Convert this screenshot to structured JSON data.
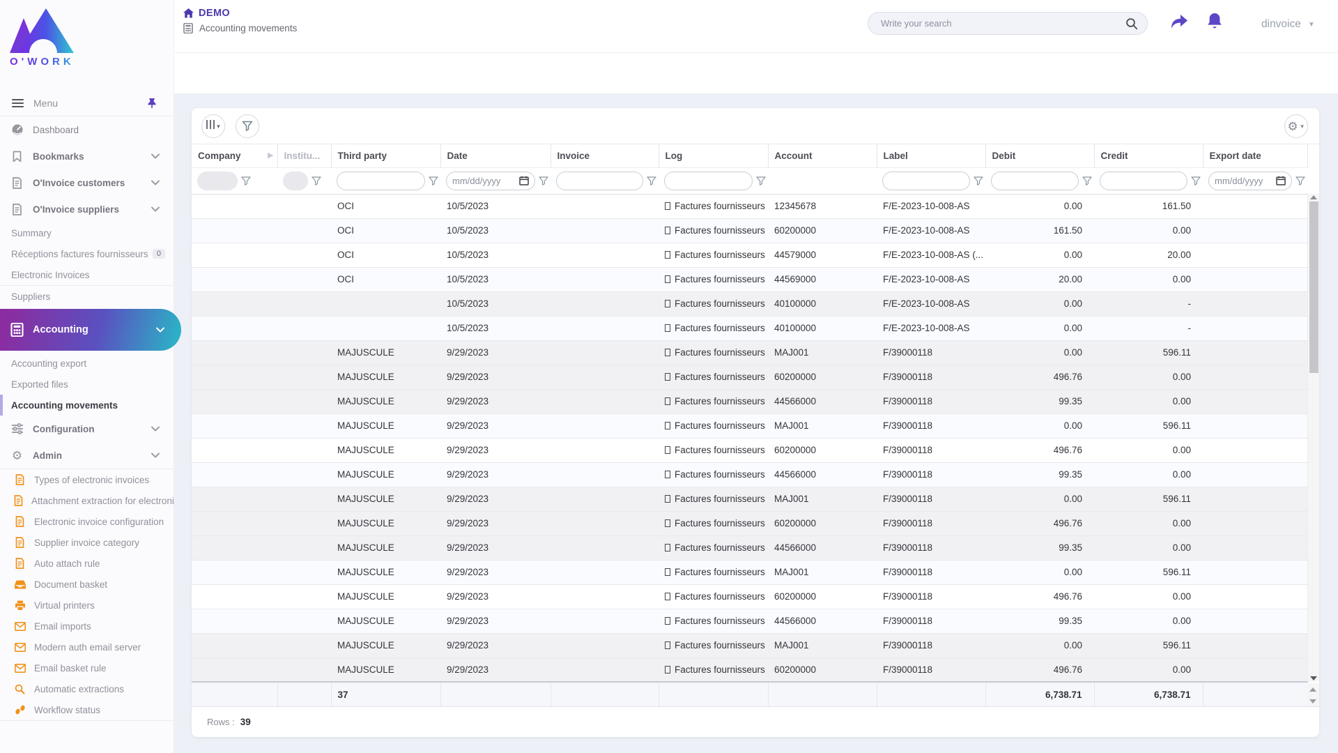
{
  "app": {
    "logo_text": "O'WORK",
    "accent_purple": "#5b46c6",
    "accent_teal": "#28b9c7",
    "admin_icon_orange": "#f2921c",
    "active_gradient": [
      "#8a2da1",
      "#28b9c7"
    ]
  },
  "header": {
    "title": "DEMO",
    "breadcrumb": "Accounting movements",
    "search_placeholder": "Write your search",
    "user": "dinvoice"
  },
  "sidebar": {
    "menu_label": "Menu",
    "items": [
      {
        "id": "dashboard",
        "label": "Dashboard",
        "icon": "dashboard",
        "type": "top"
      },
      {
        "id": "bookmarks",
        "label": "Bookmarks",
        "icon": "bookmark",
        "type": "top",
        "bold": true,
        "chevron": true
      },
      {
        "id": "oinvoice-customers",
        "label": "O'Invoice customers",
        "icon": "invoice",
        "type": "top",
        "bold": true,
        "chevron": true
      },
      {
        "id": "oinvoice-suppliers",
        "label": "O'Invoice suppliers",
        "icon": "invoice",
        "type": "top",
        "bold": true,
        "chevron": true
      },
      {
        "id": "summary",
        "label": "Summary",
        "type": "sub"
      },
      {
        "id": "receptions-factures-fournisseurs",
        "label": "Réceptions factures fournisseurs",
        "type": "sub",
        "badge": "0"
      },
      {
        "id": "electronic-invoices",
        "label": "Electronic Invoices",
        "type": "sub"
      },
      {
        "type": "divider"
      },
      {
        "id": "suppliers",
        "label": "Suppliers",
        "type": "sub"
      },
      {
        "id": "accounting",
        "label": "Accounting",
        "icon": "calculator",
        "type": "pill",
        "chevron": true
      },
      {
        "id": "accounting-export",
        "label": "Accounting export",
        "type": "sub"
      },
      {
        "id": "exported-files",
        "label": "Exported files",
        "type": "sub"
      },
      {
        "id": "accounting-movements",
        "label": "Accounting movements",
        "type": "sub",
        "active": true
      },
      {
        "id": "configuration",
        "label": "Configuration",
        "icon": "sliders",
        "type": "top",
        "bold": true,
        "chevron": true
      },
      {
        "id": "admin",
        "label": "Admin",
        "icon": "gear",
        "type": "top",
        "bold": true,
        "chevron": true
      },
      {
        "type": "divider"
      },
      {
        "id": "types-of-electronic-invoices",
        "label": "Types of electronic invoices",
        "icon": "doc-orange",
        "type": "admin"
      },
      {
        "id": "attachment-extraction",
        "label": "Attachment extraction for electroni",
        "icon": "doc-orange",
        "type": "admin"
      },
      {
        "id": "electronic-invoice-configuration",
        "label": "Electronic invoice configuration",
        "icon": "doc-orange",
        "type": "admin"
      },
      {
        "id": "supplier-invoice-category",
        "label": "Supplier invoice category",
        "icon": "doc-orange",
        "type": "admin"
      },
      {
        "id": "auto-attach-rule",
        "label": "Auto attach rule",
        "icon": "doc-orange",
        "type": "admin"
      },
      {
        "id": "document-basket",
        "label": "Document basket",
        "icon": "inbox",
        "type": "admin"
      },
      {
        "id": "virtual-printers",
        "label": "Virtual printers",
        "icon": "printer",
        "type": "admin"
      },
      {
        "id": "email-imports",
        "label": "Email imports",
        "icon": "envelope",
        "type": "admin"
      },
      {
        "id": "modern-auth-email-server",
        "label": "Modern auth email server",
        "icon": "envelope",
        "type": "admin"
      },
      {
        "id": "email-basket-rule",
        "label": "Email basket rule",
        "icon": "envelope",
        "type": "admin"
      },
      {
        "id": "automatic-extractions",
        "label": "Automatic extractions",
        "icon": "magnifier-orange",
        "type": "admin"
      },
      {
        "id": "workflow-status",
        "label": "Workflow status",
        "icon": "footprints",
        "type": "admin"
      },
      {
        "type": "divider"
      }
    ]
  },
  "toolbar": {
    "buttons": [
      "column-chooser",
      "filter"
    ],
    "settings_button": "gear"
  },
  "table": {
    "columns": [
      {
        "key": "company",
        "label": "Company",
        "filter": "disabled"
      },
      {
        "key": "institution",
        "label": "Institu...",
        "filter": "disabled",
        "muted": true
      },
      {
        "key": "third_party",
        "label": "Third party",
        "filter": "text"
      },
      {
        "key": "date",
        "label": "Date",
        "filter": "date"
      },
      {
        "key": "invoice",
        "label": "Invoice",
        "filter": "text"
      },
      {
        "key": "log",
        "label": "Log",
        "filter": "text"
      },
      {
        "key": "account",
        "label": "Account",
        "filter": "none"
      },
      {
        "key": "label",
        "label": "Label",
        "filter": "text"
      },
      {
        "key": "debit",
        "label": "Debit",
        "filter": "text",
        "align": "right"
      },
      {
        "key": "credit",
        "label": "Credit",
        "filter": "text",
        "align": "right"
      },
      {
        "key": "export_date",
        "label": "Export date",
        "filter": "date"
      }
    ],
    "date_placeholder": "mm/dd/yyyy",
    "rows": [
      {
        "company": "",
        "institution": "",
        "third_party": "OCI",
        "date": "10/5/2023",
        "invoice": "",
        "log": "Factures fournisseurs",
        "account": "12345678",
        "label": "F/E-2023-10-008-AS",
        "debit": "0.00",
        "credit": "161.50",
        "export_date": "",
        "shade": "white"
      },
      {
        "company": "",
        "institution": "",
        "third_party": "OCI",
        "date": "10/5/2023",
        "invoice": "",
        "log": "Factures fournisseurs",
        "account": "60200000",
        "label": "F/E-2023-10-008-AS",
        "debit": "161.50",
        "credit": "0.00",
        "export_date": "",
        "shade": "stripe"
      },
      {
        "company": "",
        "institution": "",
        "third_party": "OCI",
        "date": "10/5/2023",
        "invoice": "",
        "log": "Factures fournisseurs",
        "account": "44579000",
        "label": "F/E-2023-10-008-AS (...",
        "debit": "0.00",
        "credit": "20.00",
        "export_date": "",
        "shade": "white"
      },
      {
        "company": "",
        "institution": "",
        "third_party": "OCI",
        "date": "10/5/2023",
        "invoice": "",
        "log": "Factures fournisseurs",
        "account": "44569000",
        "label": "F/E-2023-10-008-AS",
        "debit": "20.00",
        "credit": "0.00",
        "export_date": "",
        "shade": "stripe"
      },
      {
        "company": "",
        "institution": "",
        "third_party": "",
        "date": "10/5/2023",
        "invoice": "",
        "log": "Factures fournisseurs",
        "account": "40100000",
        "label": "F/E-2023-10-008-AS",
        "debit": "0.00",
        "credit": "-",
        "export_date": "",
        "shade": "gray"
      },
      {
        "company": "",
        "institution": "",
        "third_party": "",
        "date": "10/5/2023",
        "invoice": "",
        "log": "Factures fournisseurs",
        "account": "40100000",
        "label": "F/E-2023-10-008-AS",
        "debit": "0.00",
        "credit": "-",
        "export_date": "",
        "shade": "stripe"
      },
      {
        "company": "",
        "institution": "",
        "third_party": "MAJUSCULE",
        "date": "9/29/2023",
        "invoice": "",
        "log": "Factures fournisseurs",
        "account": "MAJ001",
        "label": "F/39000118",
        "debit": "0.00",
        "credit": "596.11",
        "export_date": "",
        "shade": "gray"
      },
      {
        "company": "",
        "institution": "",
        "third_party": "MAJUSCULE",
        "date": "9/29/2023",
        "invoice": "",
        "log": "Factures fournisseurs",
        "account": "60200000",
        "label": "F/39000118",
        "debit": "496.76",
        "credit": "0.00",
        "export_date": "",
        "shade": "gray"
      },
      {
        "company": "",
        "institution": "",
        "third_party": "MAJUSCULE",
        "date": "9/29/2023",
        "invoice": "",
        "log": "Factures fournisseurs",
        "account": "44566000",
        "label": "F/39000118",
        "debit": "99.35",
        "credit": "0.00",
        "export_date": "",
        "shade": "gray"
      },
      {
        "company": "",
        "institution": "",
        "third_party": "MAJUSCULE",
        "date": "9/29/2023",
        "invoice": "",
        "log": "Factures fournisseurs",
        "account": "MAJ001",
        "label": "F/39000118",
        "debit": "0.00",
        "credit": "596.11",
        "export_date": "",
        "shade": "stripe"
      },
      {
        "company": "",
        "institution": "",
        "third_party": "MAJUSCULE",
        "date": "9/29/2023",
        "invoice": "",
        "log": "Factures fournisseurs",
        "account": "60200000",
        "label": "F/39000118",
        "debit": "496.76",
        "credit": "0.00",
        "export_date": "",
        "shade": "white"
      },
      {
        "company": "",
        "institution": "",
        "third_party": "MAJUSCULE",
        "date": "9/29/2023",
        "invoice": "",
        "log": "Factures fournisseurs",
        "account": "44566000",
        "label": "F/39000118",
        "debit": "99.35",
        "credit": "0.00",
        "export_date": "",
        "shade": "stripe"
      },
      {
        "company": "",
        "institution": "",
        "third_party": "MAJUSCULE",
        "date": "9/29/2023",
        "invoice": "",
        "log": "Factures fournisseurs",
        "account": "MAJ001",
        "label": "F/39000118",
        "debit": "0.00",
        "credit": "596.11",
        "export_date": "",
        "shade": "gray"
      },
      {
        "company": "",
        "institution": "",
        "third_party": "MAJUSCULE",
        "date": "9/29/2023",
        "invoice": "",
        "log": "Factures fournisseurs",
        "account": "60200000",
        "label": "F/39000118",
        "debit": "496.76",
        "credit": "0.00",
        "export_date": "",
        "shade": "gray"
      },
      {
        "company": "",
        "institution": "",
        "third_party": "MAJUSCULE",
        "date": "9/29/2023",
        "invoice": "",
        "log": "Factures fournisseurs",
        "account": "44566000",
        "label": "F/39000118",
        "debit": "99.35",
        "credit": "0.00",
        "export_date": "",
        "shade": "gray"
      },
      {
        "company": "",
        "institution": "",
        "third_party": "MAJUSCULE",
        "date": "9/29/2023",
        "invoice": "",
        "log": "Factures fournisseurs",
        "account": "MAJ001",
        "label": "F/39000118",
        "debit": "0.00",
        "credit": "596.11",
        "export_date": "",
        "shade": "stripe"
      },
      {
        "company": "",
        "institution": "",
        "third_party": "MAJUSCULE",
        "date": "9/29/2023",
        "invoice": "",
        "log": "Factures fournisseurs",
        "account": "60200000",
        "label": "F/39000118",
        "debit": "496.76",
        "credit": "0.00",
        "export_date": "",
        "shade": "white"
      },
      {
        "company": "",
        "institution": "",
        "third_party": "MAJUSCULE",
        "date": "9/29/2023",
        "invoice": "",
        "log": "Factures fournisseurs",
        "account": "44566000",
        "label": "F/39000118",
        "debit": "99.35",
        "credit": "0.00",
        "export_date": "",
        "shade": "stripe"
      },
      {
        "company": "",
        "institution": "",
        "third_party": "MAJUSCULE",
        "date": "9/29/2023",
        "invoice": "",
        "log": "Factures fournisseurs",
        "account": "MAJ001",
        "label": "F/39000118",
        "debit": "0.00",
        "credit": "596.11",
        "export_date": "",
        "shade": "gray"
      },
      {
        "company": "",
        "institution": "",
        "third_party": "MAJUSCULE",
        "date": "9/29/2023",
        "invoice": "",
        "log": "Factures fournisseurs",
        "account": "60200000",
        "label": "F/39000118",
        "debit": "496.76",
        "credit": "0.00",
        "export_date": "",
        "shade": "gray"
      }
    ],
    "totals": {
      "third_party": "37",
      "debit": "6,738.71",
      "credit": "6,738.71"
    },
    "footer": {
      "rows_label": "Rows :",
      "rows_value": "39"
    }
  }
}
